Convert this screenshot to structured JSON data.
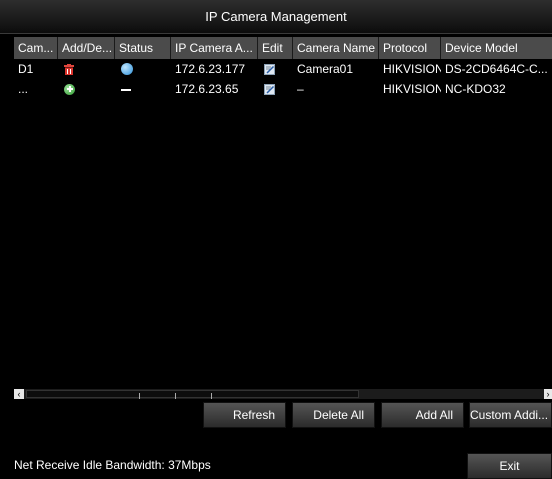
{
  "window": {
    "title": "IP Camera Management"
  },
  "table": {
    "headers": [
      "Cam...",
      "Add/De...",
      "Status",
      "IP Camera A...",
      "Edit",
      "Camera Name",
      "Protocol",
      "Device Model"
    ],
    "rows": [
      {
        "camera": "D1",
        "add_delete_icon": "delete-icon",
        "status_icon": "online-status-icon",
        "ip": "172.6.23.177",
        "edit_icon": "edit-icon",
        "name": "Camera01",
        "protocol": "HIKVISION",
        "model": "DS-2CD6464C-C..."
      },
      {
        "camera": "...",
        "add_delete_icon": "add-icon",
        "status_icon": "none",
        "ip": "172.6.23.65",
        "edit_icon": "edit-icon",
        "name": "–",
        "protocol": "HIKVISION",
        "model": "NC-KDO32"
      }
    ]
  },
  "buttons": {
    "refresh": "Refresh",
    "delete_all": "Delete All",
    "add_all": "Add All",
    "custom_add": "Custom Addi...",
    "exit": "Exit"
  },
  "footer": {
    "bandwidth": "Net Receive Idle Bandwidth: 37Mbps"
  },
  "colors": {
    "header_bg": "#4b4b4b",
    "delete_icon": "#d9322b",
    "add_icon": "#2f9a2f",
    "status_online": "#2b8fd8"
  }
}
